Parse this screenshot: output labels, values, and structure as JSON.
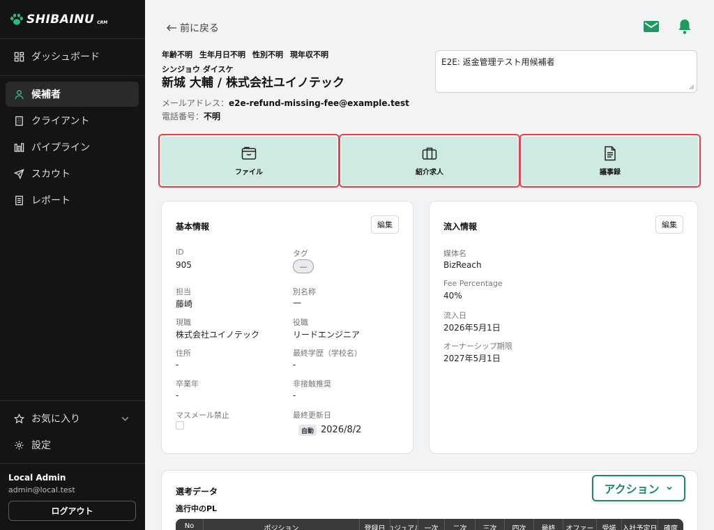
{
  "app": {
    "logo_text": "SHIBAINU",
    "logo_sub": "CRM"
  },
  "sidebar": {
    "items": [
      {
        "label": "ダッシュボード",
        "icon": "dashboard-icon"
      },
      {
        "label": "候補者",
        "icon": "person-icon",
        "active": true
      },
      {
        "label": "クライアント",
        "icon": "building-icon"
      },
      {
        "label": "パイプライン",
        "icon": "bar-chart-icon"
      },
      {
        "label": "スカウト",
        "icon": "send-icon"
      },
      {
        "label": "レポート",
        "icon": "report-icon"
      }
    ],
    "favorites_label": "お気に入り",
    "settings_label": "設定",
    "user": {
      "name": "Local Admin",
      "email": "admin@local.test"
    },
    "logout_label": "ログアウト"
  },
  "header": {
    "back_label": "前に戻る"
  },
  "candidate": {
    "meta": [
      "年齢不明",
      "生年月日不明",
      "性別不明",
      "現年収不明"
    ],
    "kana": "シンジョウ ダイスケ",
    "name": "新城 大輔 / 株式会社ユイノテック",
    "email_label": "メールアドレス：",
    "email": "e2e-refund-missing-fee@example.test",
    "phone_label": "電話番号：",
    "phone": "不明",
    "memo": "E2E: 返金管理テスト用候補者"
  },
  "tiles": [
    {
      "label": "ファイル",
      "icon": "folder-icon"
    },
    {
      "label": "紹介求人",
      "icon": "briefcase-icon"
    },
    {
      "label": "議事録",
      "icon": "document-icon"
    }
  ],
  "basic_info": {
    "title": "基本情報",
    "edit_label": "編集",
    "id_label": "ID",
    "id": "905",
    "tag_label": "タグ",
    "tag": "—",
    "owner_label": "担当",
    "owner": "藤崎",
    "alias_label": "別名称",
    "alias": "—",
    "current_job_label": "現職",
    "current_job": "株式会社ユイノテック",
    "role_label": "役職",
    "role": "リードエンジニア",
    "address_label": "住所",
    "address": "-",
    "education_label": "最終学歴（学校名）",
    "education": "-",
    "grad_year_label": "卒業年",
    "grad_year": "-",
    "no_contact_label": "非接触推奨",
    "no_contact": "-",
    "mass_mail_label": "マスメール禁止",
    "updated_label": "最終更新日",
    "auto_badge": "自動",
    "updated": "2026/8/2"
  },
  "inflow_info": {
    "title": "流入情報",
    "edit_label": "編集",
    "media_label": "媒体名",
    "media": "BizReach",
    "fee_label": "Fee Percentage",
    "fee": "40%",
    "inflow_date_label": "流入日",
    "inflow_date": "2026年5月1日",
    "ownership_label": "オーナーシップ期限",
    "ownership": "2027年5月1日"
  },
  "selection": {
    "title": "選考データ",
    "subtitle": "進行中のPL",
    "action_label": "アクション",
    "columns": [
      "No",
      "ポジション",
      "登録日",
      "カジュアル",
      "一次",
      "二次",
      "三次",
      "四次",
      "最終",
      "オファー",
      "受諾",
      "入社予定日",
      "確度"
    ]
  },
  "colors": {
    "accent": "#1f8a5f",
    "tile_bg": "#cfeae2",
    "highlight": "#e0444e",
    "sidebar_bg": "#141414"
  }
}
